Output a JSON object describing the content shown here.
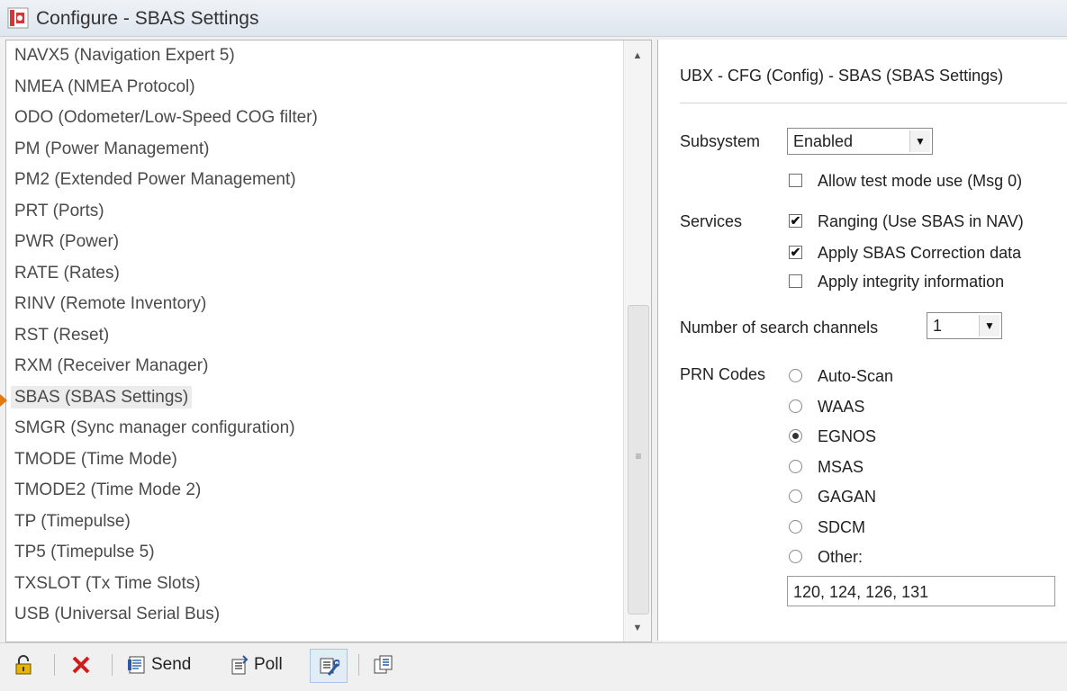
{
  "window": {
    "title": "Configure - SBAS Settings"
  },
  "list": {
    "items": [
      "NAVX5 (Navigation Expert 5)",
      "NMEA (NMEA Protocol)",
      "ODO (Odometer/Low-Speed COG filter)",
      "PM (Power Management)",
      "PM2 (Extended Power Management)",
      "PRT (Ports)",
      "PWR (Power)",
      "RATE (Rates)",
      "RINV (Remote Inventory)",
      "RST (Reset)",
      "RXM (Receiver Manager)",
      "SBAS (SBAS Settings)",
      "SMGR (Sync manager configuration)",
      "TMODE (Time Mode)",
      "TMODE2 (Time Mode 2)",
      "TP (Timepulse)",
      "TP5 (Timepulse 5)",
      "TXSLOT (Tx Time Slots)",
      "USB (Universal Serial Bus)"
    ],
    "selected": "SBAS (SBAS Settings)"
  },
  "panel": {
    "title": "UBX - CFG (Config) - SBAS (SBAS Settings)",
    "subsystem_label": "Subsystem",
    "subsystem_value": "Enabled",
    "test_mode_label": "Allow test mode use (Msg 0)",
    "test_mode_checked": false,
    "services_label": "Services",
    "services": [
      {
        "label": "Ranging (Use SBAS in NAV)",
        "checked": true
      },
      {
        "label": "Apply SBAS Correction data",
        "checked": true
      },
      {
        "label": "Apply integrity information",
        "checked": false
      }
    ],
    "channels_label": "Number of search channels",
    "channels_value": "1",
    "prn_label": "PRN Codes",
    "prn_options": [
      "Auto-Scan",
      "WAAS",
      "EGNOS",
      "MSAS",
      "GAGAN",
      "SDCM",
      "Other:"
    ],
    "prn_selected": "EGNOS",
    "other_value": "120, 124, 126, 131"
  },
  "toolbar": {
    "send_label": "Send",
    "poll_label": "Poll"
  },
  "icons": {
    "lock": "lock-icon",
    "cancel": "close-icon",
    "send": "send-icon",
    "poll": "poll-icon",
    "tools": "tools-icon",
    "copy": "copy-icon"
  },
  "colors": {
    "cancel_red": "#d41b1b",
    "marker_orange": "#e07a10",
    "lock_yellow": "#e8b400"
  }
}
